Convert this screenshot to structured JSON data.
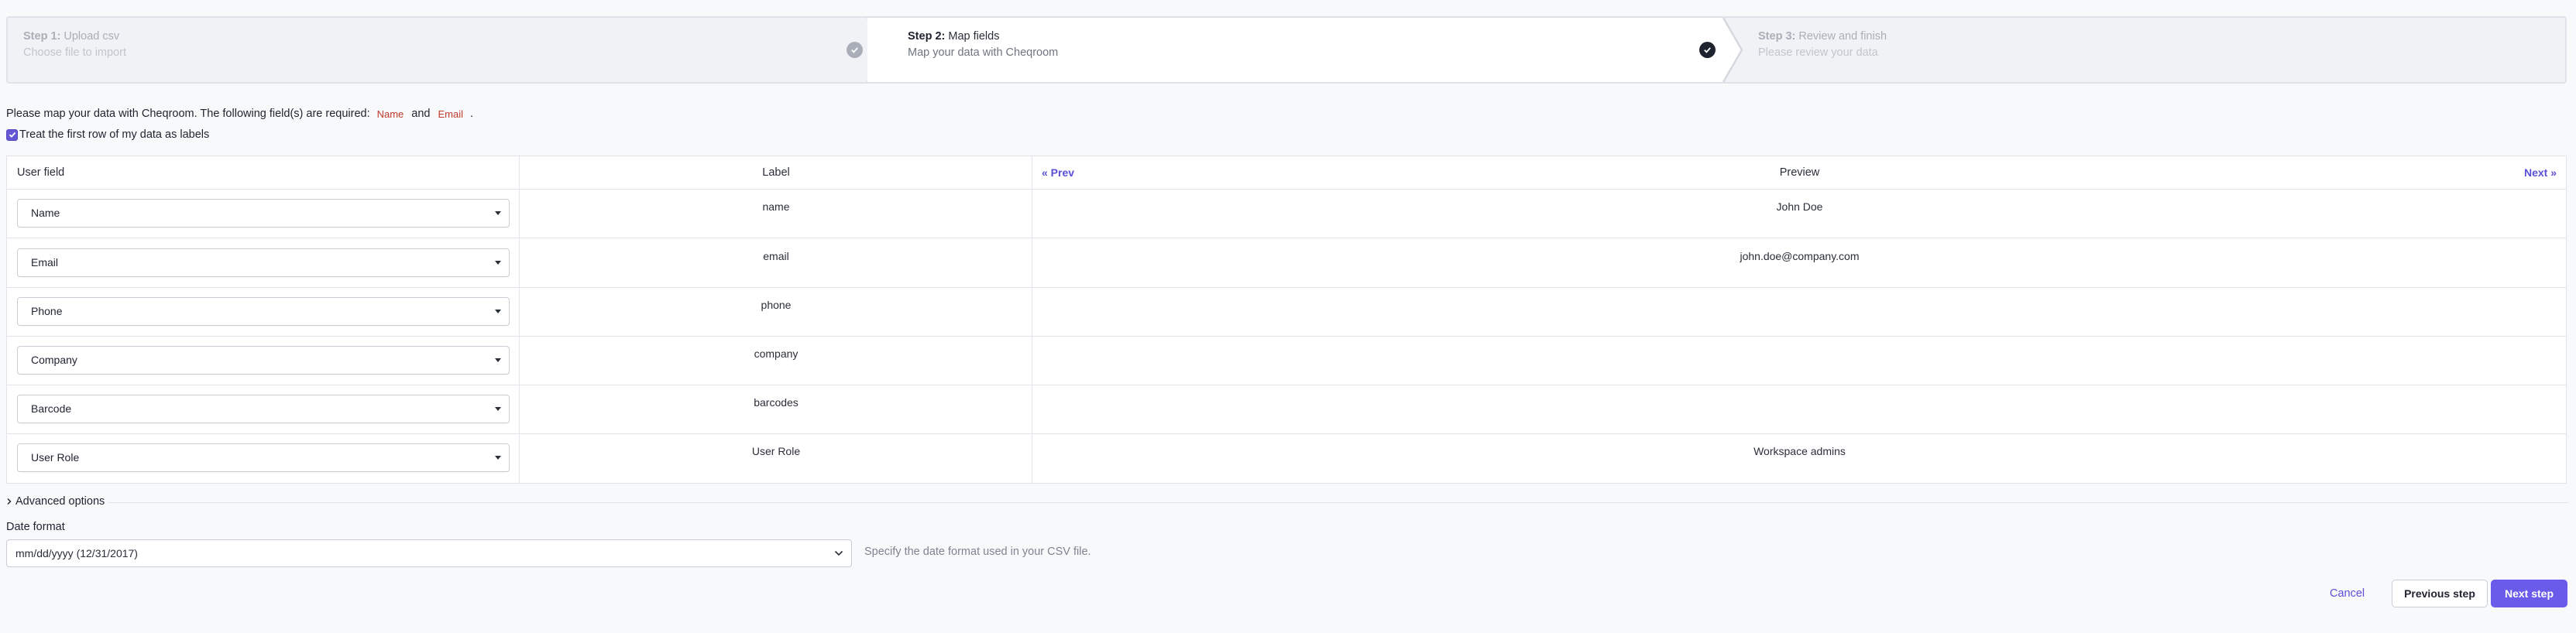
{
  "steps": [
    {
      "prefix": "Step 1:",
      "name": "Upload csv",
      "subtitle": "Choose file to import",
      "state": "done"
    },
    {
      "prefix": "Step 2:",
      "name": "Map fields",
      "subtitle": "Map your data with Cheqroom",
      "state": "current"
    },
    {
      "prefix": "Step 3:",
      "name": "Review and finish",
      "subtitle": "Please review your data",
      "state": "upcoming"
    }
  ],
  "intro": {
    "text": "Please map your data with Cheqroom. The following field(s) are required:",
    "required": [
      "Name",
      "Email"
    ],
    "and": "and",
    "end": "."
  },
  "treat_first_row": {
    "label": "Treat the first row of my data as labels",
    "checked": true
  },
  "table": {
    "headers": {
      "user_field": "User field",
      "label": "Label",
      "preview": "Preview"
    },
    "prev": "« Prev",
    "next": "Next »",
    "rows": [
      {
        "field": "Name",
        "label": "name",
        "preview": "John Doe"
      },
      {
        "field": "Email",
        "label": "email",
        "preview": "john.doe@company.com"
      },
      {
        "field": "Phone",
        "label": "phone",
        "preview": ""
      },
      {
        "field": "Company",
        "label": "company",
        "preview": ""
      },
      {
        "field": "Barcode",
        "label": "barcodes",
        "preview": ""
      },
      {
        "field": "User Role",
        "label": "User Role",
        "preview": "Workspace admins"
      }
    ]
  },
  "advanced": {
    "label": "Advanced options"
  },
  "date_format": {
    "label": "Date format",
    "value": "mm/dd/yyyy (12/31/2017)",
    "hint": "Specify the date format used in your CSV file."
  },
  "footer": {
    "cancel": "Cancel",
    "previous": "Previous step",
    "next": "Next step"
  },
  "colors": {
    "accent": "#6a5bea",
    "link": "#5a50d8",
    "required": "#c0392b"
  },
  "icons": [
    "check-circle-icon",
    "checkbox-check-icon",
    "caret-down-icon",
    "chevron-right-icon",
    "chevron-down-icon"
  ]
}
